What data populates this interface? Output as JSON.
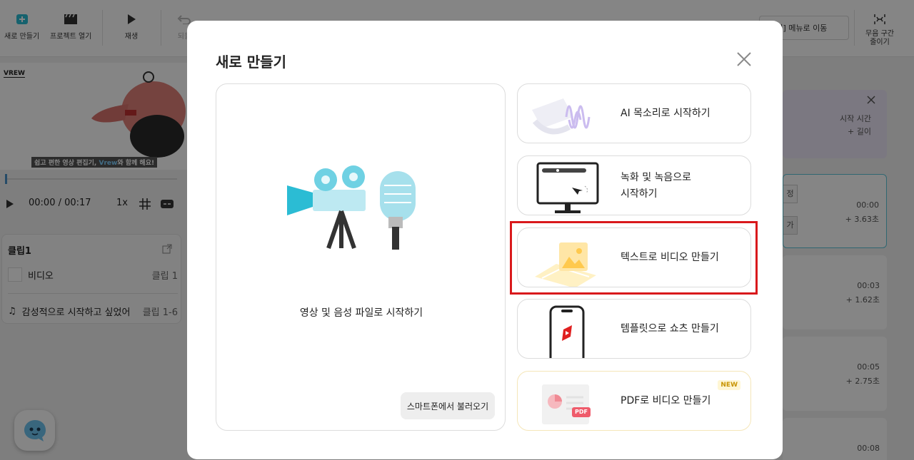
{
  "toolbar": {
    "new_label": "새로 만들기",
    "open_label": "프로젝트 열기",
    "play_label": "재생",
    "undo_label": "되돌",
    "format_menu_label": "[서식] 메뉴로 이동",
    "shorten_silence_label": "무음 구간\n줄이기"
  },
  "preview": {
    "watermark": "VREW",
    "caption_pre": "쉽고 편한 영상 편집기, ",
    "caption_brand": "Vrew",
    "caption_post": "와 함께 해요!"
  },
  "player": {
    "time": "00:00 / 00:17",
    "speed": "1x"
  },
  "clip_panel": {
    "title": "클립1",
    "rows": [
      {
        "left": "비디오",
        "right": "클립 1"
      },
      {
        "left": "감성적으로 시작하고 싶었어",
        "right": "클립 1-6"
      }
    ]
  },
  "right_pane": {
    "info_title": "시작 시간",
    "info_sub": "+ 길이",
    "btn_a": "정",
    "btn_b": "가",
    "rows": [
      {
        "time": "00:00",
        "dur": "+ 3.63초"
      },
      {
        "time": "00:03",
        "dur": "+ 1.62초"
      },
      {
        "time": "00:05",
        "dur": "+ 2.75초"
      },
      {
        "time": "00:08",
        "dur": ""
      }
    ]
  },
  "modal": {
    "title": "새로 만들기",
    "big_card_label": "영상 및 음성 파일로 시작하기",
    "phone_import_label": "스마트폰에서 불러오기",
    "options": [
      {
        "label": "AI 목소리로 시작하기"
      },
      {
        "label": "녹화 및 녹음으로\n시작하기"
      },
      {
        "label": "텍스트로 비디오 만들기"
      },
      {
        "label": "템플릿으로 쇼츠 만들기"
      },
      {
        "label": "PDF로 비디오 만들기",
        "badge": "NEW"
      }
    ],
    "pdf_tag": "PDF"
  },
  "colors": {
    "highlight": "#d9191c",
    "accent_teal": "#2bbcd4",
    "overlay": "rgba(0,0,0,0.48)"
  }
}
